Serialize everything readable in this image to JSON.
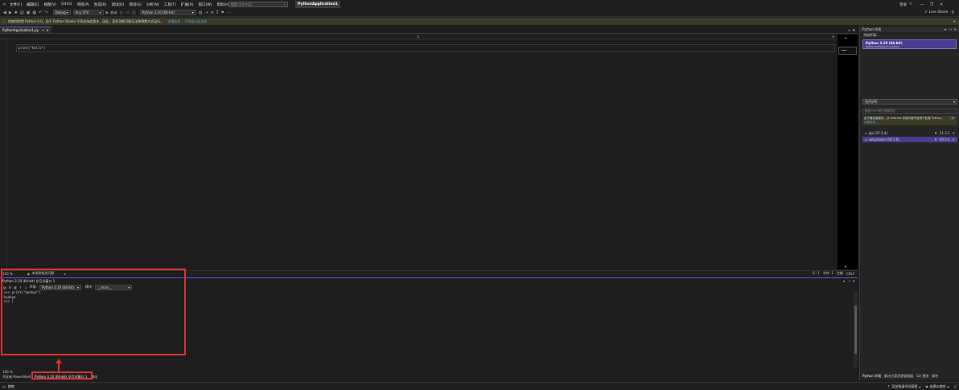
{
  "menu": {
    "items": [
      "文件(F)",
      "编辑(E)",
      "视图(V)",
      "Git(G)",
      "项目(P)",
      "生成(B)",
      "调试(D)",
      "测试(S)",
      "分析(N)",
      "工具(T)",
      "扩展(X)",
      "窗口(W)",
      "帮助(H)"
    ],
    "search_placeholder": "搜索 (Ctrl+Q)",
    "project_title": "PythonApplication1",
    "signin": "登录",
    "live_share": "Live Share"
  },
  "toolbar": {
    "config": "Debug",
    "platform": "Any CPU",
    "start_label": "启动",
    "interpreter": "Python 3.10 (64-bit)"
  },
  "infobar": {
    "message": "你使用的是 Python 0.0。由于 Python Studio 不再支持此版本，因此，某些功能可能无法按预期方式运行。",
    "link1": "详细信息",
    "link2": "不再显示此消息"
  },
  "editor": {
    "tab_label": "PythonApplication1.py",
    "code": "print(\"hello\")"
  },
  "editor_status": {
    "zoom": "100 %",
    "issues": "未找到相关问题",
    "line": "行: 1",
    "char": "字符: 1",
    "spaces": "空格",
    "crlf": "CRLF"
  },
  "panel": {
    "title": "Python 3.10 (64-bit) 交互式窗口 1",
    "env_label": "环境:",
    "env_value": "Python 3.10 (64-bit)",
    "module_label": "模块:",
    "module_value": "__main__",
    "lines": [
      ">>> print(\"byebye\")",
      "byebye",
      ">>> |"
    ]
  },
  "bottom": {
    "zoom": "100 %",
    "tabs": [
      "开发者 PowerShell",
      "Python 3.10 (64-bit) 交互式窗口 1",
      "输出"
    ]
  },
  "statusbar": {
    "ready": "就绪",
    "source_control": "添加到源代码管理",
    "repo": "选择存储库"
  },
  "rightpane": {
    "title": "Python 环境",
    "add_env": "添加环境...",
    "env_name": "Python 3.10 (64-bit)",
    "env_sub": "Python Software Foundation",
    "pkg_view": "包(PyPI)",
    "pkg_search": "搜索 PyPI 和已安装的包",
    "admin_warn": "由于要安装程序，从 Internet 安装可能不适用于此版 Python。",
    "admin_link": "了解详细信息",
    "packages": [
      {
        "name": "pip (21.2.4)",
        "version": "21.3.1"
      },
      {
        "name": "setuptools (58.1.0)",
        "version": "60.0.4"
      }
    ],
    "bottom_tabs": [
      "Python 环境",
      "解决方案资源管理器",
      "Git 更改",
      "属性"
    ]
  }
}
